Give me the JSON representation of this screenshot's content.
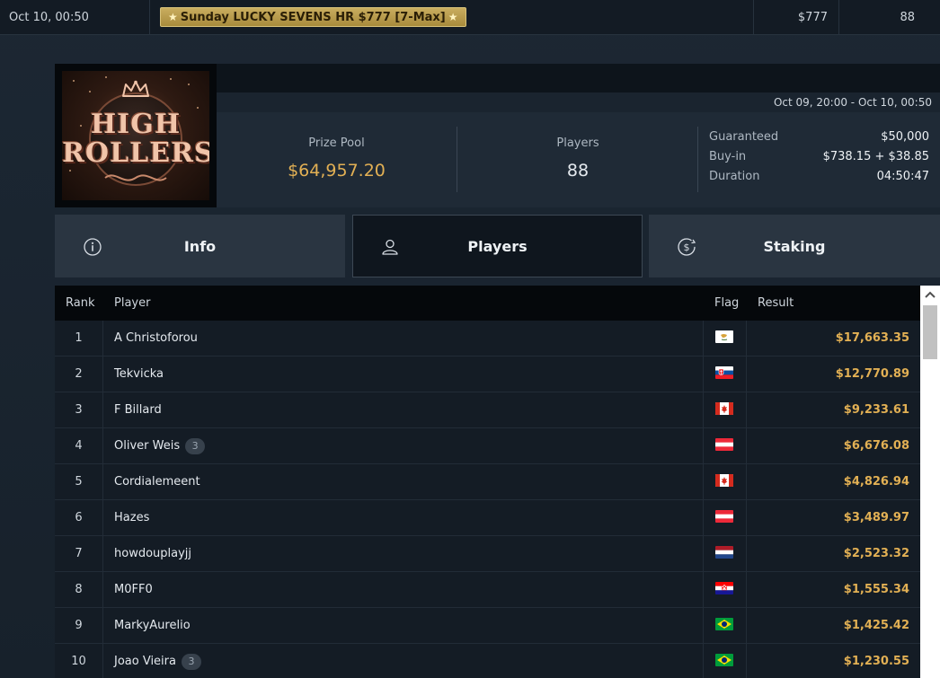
{
  "top_row": {
    "date": "Oct 10, 00:50",
    "tournament_name": "Sunday LUCKY SEVENS HR $777 [7-Max]",
    "buy_in": "$777",
    "players": "88"
  },
  "header": {
    "logo_text_1": "HIGH",
    "logo_text_2": "ROLLERS",
    "date_range": "Oct 09, 20:00 - Oct 10, 00:50",
    "prize_pool_label": "Prize Pool",
    "prize_pool_value": "$64,957.20",
    "players_label": "Players",
    "players_value": "88",
    "details": [
      {
        "key": "Guaranteed",
        "value": "$50,000"
      },
      {
        "key": "Buy-in",
        "value": "$738.15 + $38.85"
      },
      {
        "key": "Duration",
        "value": "04:50:47"
      }
    ]
  },
  "tabs": {
    "info": "Info",
    "players": "Players",
    "staking": "Staking",
    "active": "players"
  },
  "table": {
    "headers": {
      "rank": "Rank",
      "player": "Player",
      "flag": "Flag",
      "result": "Result"
    },
    "rows": [
      {
        "rank": "1",
        "player": "A Christoforou",
        "badge": "",
        "flag": "cyprus",
        "result": "$17,663.35"
      },
      {
        "rank": "2",
        "player": "Tekvicka",
        "badge": "",
        "flag": "slovakia",
        "result": "$12,770.89"
      },
      {
        "rank": "3",
        "player": "F Billard",
        "badge": "",
        "flag": "canada",
        "result": "$9,233.61"
      },
      {
        "rank": "4",
        "player": "Oliver Weis",
        "badge": "3",
        "flag": "austria",
        "result": "$6,676.08"
      },
      {
        "rank": "5",
        "player": "Cordialemeent",
        "badge": "",
        "flag": "canada",
        "result": "$4,826.94"
      },
      {
        "rank": "6",
        "player": "Hazes",
        "badge": "",
        "flag": "austria",
        "result": "$3,489.97"
      },
      {
        "rank": "7",
        "player": "howdouplayjj",
        "badge": "",
        "flag": "netherlands",
        "result": "$2,523.32"
      },
      {
        "rank": "8",
        "player": "M0FF0",
        "badge": "",
        "flag": "croatia",
        "result": "$1,555.34"
      },
      {
        "rank": "9",
        "player": "MarkyAurelio",
        "badge": "",
        "flag": "brazil",
        "result": "$1,425.42"
      },
      {
        "rank": "10",
        "player": "Joao Vieira",
        "badge": "3",
        "flag": "brazil",
        "result": "$1,230.55"
      }
    ]
  },
  "colors": {
    "accent_gold": "#e2b054",
    "background": "#1a2430",
    "panel": "#1f2a36"
  }
}
